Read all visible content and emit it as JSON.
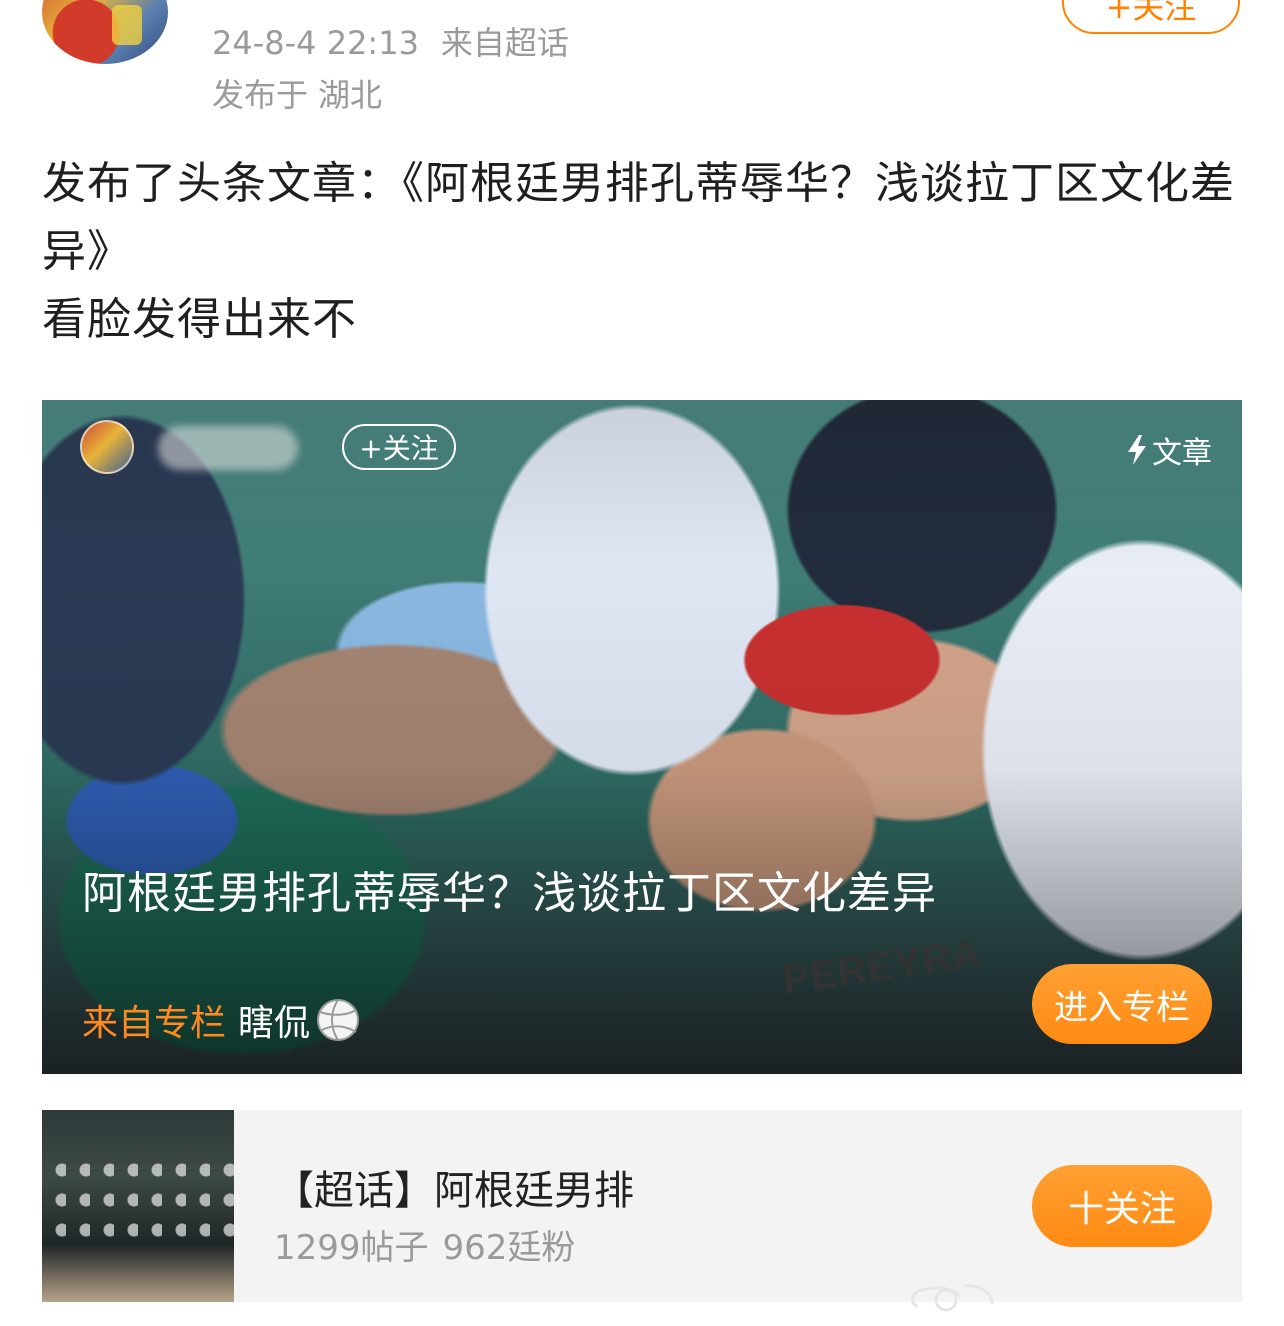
{
  "header": {
    "time": "24-8-4 22:13",
    "source": "来自超话",
    "location_prefix": "发布于",
    "location": "湖北",
    "follow_label": "+关注"
  },
  "post": {
    "lines": [
      "发布了头条文章：《阿根廷男排孔蒂辱华？浅谈拉丁区文化差异》",
      "看脸发得出来不"
    ]
  },
  "article_card": {
    "follow_label": "+关注",
    "type_label": "文章",
    "type_icon": "lightning-bolt-icon",
    "title": "阿根廷男排孔蒂辱华？浅谈拉丁区文化差异",
    "source_prefix": "来自专栏",
    "column_name": "瞎侃",
    "column_icon": "volleyball-icon",
    "enter_label": "进入专栏",
    "jersey_text": "PEREYRA",
    "accent_color": "#ff8a12"
  },
  "super_topic": {
    "name": "【超话】阿根廷男排",
    "posts": "1299帖子",
    "fans": "962廷粉",
    "follow_label": "十关注"
  }
}
